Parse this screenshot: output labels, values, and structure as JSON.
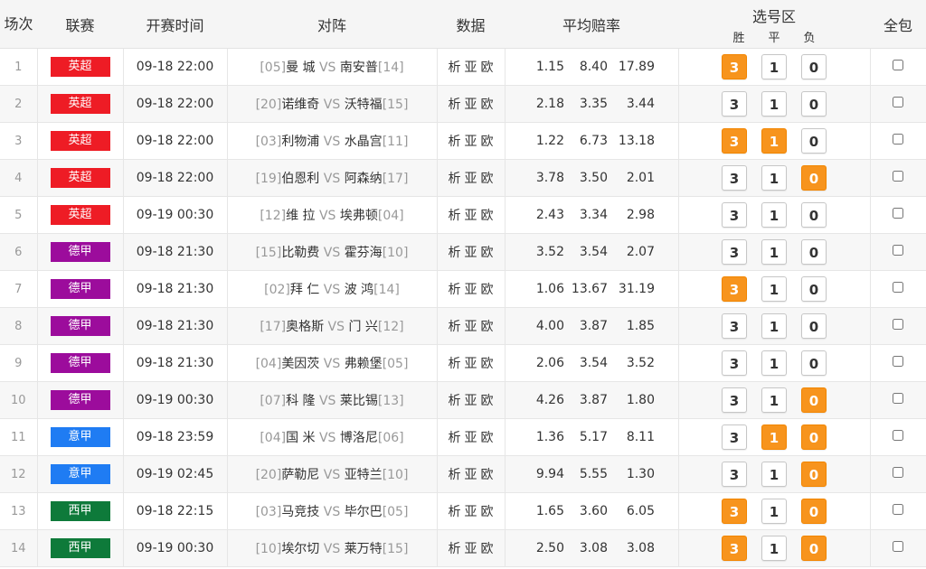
{
  "header": {
    "col_match": "场次",
    "col_league": "联赛",
    "col_time": "开赛时间",
    "col_teams": "对阵",
    "col_data": "数据",
    "col_odds": "平均赔率",
    "col_select": "选号区",
    "col_select_win": "胜",
    "col_select_draw": "平",
    "col_select_lose": "负",
    "col_all": "全包"
  },
  "colors": {
    "英超": "#ee1c25",
    "德甲": "#9c0c9c",
    "意甲": "#1f7cf3",
    "西甲": "#0e7a3a",
    "selected": "#f7941d"
  },
  "vs_text": "VS",
  "links": [
    "析",
    "亚",
    "欧"
  ],
  "pick_labels": [
    "3",
    "1",
    "0"
  ],
  "rows": [
    {
      "no": "1",
      "league": "英超",
      "time": "09-18 22:00",
      "home_rank": "[05]",
      "home": "曼 城",
      "away": "南安普",
      "away_rank": "[14]",
      "odds": [
        "1.15",
        "8.40",
        "17.89"
      ],
      "sel": [
        true,
        false,
        false
      ]
    },
    {
      "no": "2",
      "league": "英超",
      "time": "09-18 22:00",
      "home_rank": "[20]",
      "home": "诺维奇",
      "away": "沃特福",
      "away_rank": "[15]",
      "odds": [
        "2.18",
        "3.35",
        "3.44"
      ],
      "sel": [
        false,
        false,
        false
      ]
    },
    {
      "no": "3",
      "league": "英超",
      "time": "09-18 22:00",
      "home_rank": "[03]",
      "home": "利物浦",
      "away": "水晶宫",
      "away_rank": "[11]",
      "odds": [
        "1.22",
        "6.73",
        "13.18"
      ],
      "sel": [
        true,
        true,
        false
      ]
    },
    {
      "no": "4",
      "league": "英超",
      "time": "09-18 22:00",
      "home_rank": "[19]",
      "home": "伯恩利",
      "away": "阿森纳",
      "away_rank": "[17]",
      "odds": [
        "3.78",
        "3.50",
        "2.01"
      ],
      "sel": [
        false,
        false,
        true
      ]
    },
    {
      "no": "5",
      "league": "英超",
      "time": "09-19 00:30",
      "home_rank": "[12]",
      "home": "维 拉",
      "away": "埃弗顿",
      "away_rank": "[04]",
      "odds": [
        "2.43",
        "3.34",
        "2.98"
      ],
      "sel": [
        false,
        false,
        false
      ]
    },
    {
      "no": "6",
      "league": "德甲",
      "time": "09-18 21:30",
      "home_rank": "[15]",
      "home": "比勒费",
      "away": "霍芬海",
      "away_rank": "[10]",
      "odds": [
        "3.52",
        "3.54",
        "2.07"
      ],
      "sel": [
        false,
        false,
        false
      ]
    },
    {
      "no": "7",
      "league": "德甲",
      "time": "09-18 21:30",
      "home_rank": "[02]",
      "home": "拜 仁",
      "away": "波 鸿",
      "away_rank": "[14]",
      "odds": [
        "1.06",
        "13.67",
        "31.19"
      ],
      "sel": [
        true,
        false,
        false
      ]
    },
    {
      "no": "8",
      "league": "德甲",
      "time": "09-18 21:30",
      "home_rank": "[17]",
      "home": "奥格斯",
      "away": "门 兴",
      "away_rank": "[12]",
      "odds": [
        "4.00",
        "3.87",
        "1.85"
      ],
      "sel": [
        false,
        false,
        false
      ]
    },
    {
      "no": "9",
      "league": "德甲",
      "time": "09-18 21:30",
      "home_rank": "[04]",
      "home": "美因茨",
      "away": "弗赖堡",
      "away_rank": "[05]",
      "odds": [
        "2.06",
        "3.54",
        "3.52"
      ],
      "sel": [
        false,
        false,
        false
      ]
    },
    {
      "no": "10",
      "league": "德甲",
      "time": "09-19 00:30",
      "home_rank": "[07]",
      "home": "科 隆",
      "away": "莱比锡",
      "away_rank": "[13]",
      "odds": [
        "4.26",
        "3.87",
        "1.80"
      ],
      "sel": [
        false,
        false,
        true
      ]
    },
    {
      "no": "11",
      "league": "意甲",
      "time": "09-18 23:59",
      "home_rank": "[04]",
      "home": "国 米",
      "away": "博洛尼",
      "away_rank": "[06]",
      "odds": [
        "1.36",
        "5.17",
        "8.11"
      ],
      "sel": [
        false,
        true,
        true
      ]
    },
    {
      "no": "12",
      "league": "意甲",
      "time": "09-19 02:45",
      "home_rank": "[20]",
      "home": "萨勒尼",
      "away": "亚特兰",
      "away_rank": "[10]",
      "odds": [
        "9.94",
        "5.55",
        "1.30"
      ],
      "sel": [
        false,
        false,
        true
      ]
    },
    {
      "no": "13",
      "league": "西甲",
      "time": "09-18 22:15",
      "home_rank": "[03]",
      "home": "马竞技",
      "away": "毕尔巴",
      "away_rank": "[05]",
      "odds": [
        "1.65",
        "3.60",
        "6.05"
      ],
      "sel": [
        true,
        false,
        true
      ]
    },
    {
      "no": "14",
      "league": "西甲",
      "time": "09-19 00:30",
      "home_rank": "[10]",
      "home": "埃尔切",
      "away": "莱万特",
      "away_rank": "[15]",
      "odds": [
        "2.50",
        "3.08",
        "3.08"
      ],
      "sel": [
        true,
        false,
        true
      ]
    }
  ]
}
